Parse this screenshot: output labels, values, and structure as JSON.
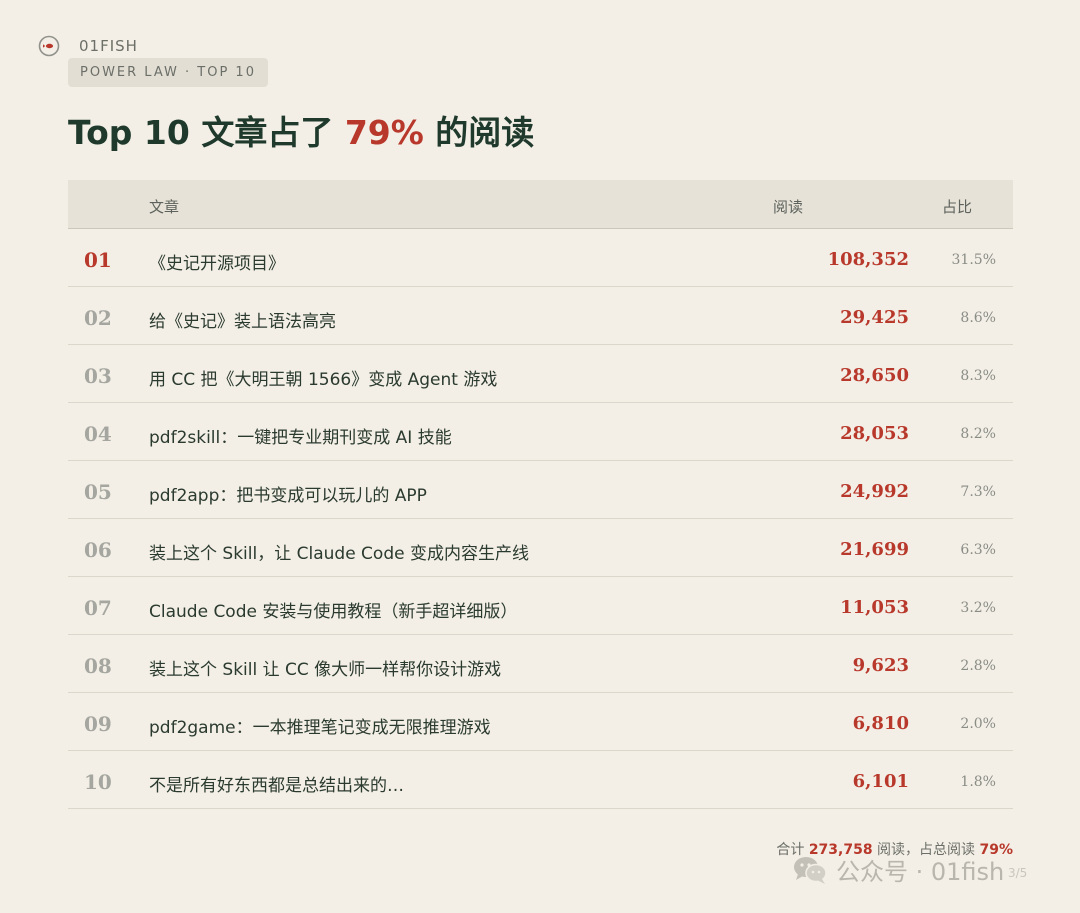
{
  "brand": {
    "name": "01FISH",
    "icon": "fish-logo-icon"
  },
  "tag": "POWER LAW · TOP 10",
  "headline": {
    "pre": "Top 10 文章占了 ",
    "accent": "79%",
    "post": " 的阅读"
  },
  "table": {
    "headers": {
      "title": "文章",
      "reads": "阅读",
      "share": "占比"
    },
    "rows": [
      {
        "rank": "01",
        "title": "《史记开源项目》",
        "reads": "108,352",
        "share": "31.5%"
      },
      {
        "rank": "02",
        "title": "给《史记》装上语法高亮",
        "reads": "29,425",
        "share": "8.6%"
      },
      {
        "rank": "03",
        "title": "用 CC 把《大明王朝 1566》变成 Agent 游戏",
        "reads": "28,650",
        "share": "8.3%"
      },
      {
        "rank": "04",
        "title": "pdf2skill：一键把专业期刊变成 AI 技能",
        "reads": "28,053",
        "share": "8.2%"
      },
      {
        "rank": "05",
        "title": "pdf2app：把书变成可以玩儿的 APP",
        "reads": "24,992",
        "share": "7.3%"
      },
      {
        "rank": "06",
        "title": "装上这个 Skill，让 Claude Code 变成内容生产线",
        "reads": "21,699",
        "share": "6.3%"
      },
      {
        "rank": "07",
        "title": "Claude Code 安装与使用教程（新手超详细版）",
        "reads": "11,053",
        "share": "3.2%"
      },
      {
        "rank": "08",
        "title": "装上这个 Skill 让 CC 像大师一样帮你设计游戏",
        "reads": "9,623",
        "share": "2.8%"
      },
      {
        "rank": "09",
        "title": "pdf2game：一本推理笔记变成无限推理游戏",
        "reads": "6,810",
        "share": "2.0%"
      },
      {
        "rank": "10",
        "title": "不是所有好东西都是总结出来的…",
        "reads": "6,101",
        "share": "1.8%"
      }
    ]
  },
  "summary": {
    "label_total": "合计 ",
    "total": "273,758",
    "label_mid": " 阅读，占总阅读 ",
    "percent": "79%"
  },
  "watermark": {
    "text": "公众号 · 01fish",
    "page": "3/5",
    "icon": "wechat-icon"
  },
  "colors": {
    "background": "#f3efe6",
    "accent": "#b8382b",
    "heading": "#1f3a2c",
    "muted": "#a4a69f"
  }
}
